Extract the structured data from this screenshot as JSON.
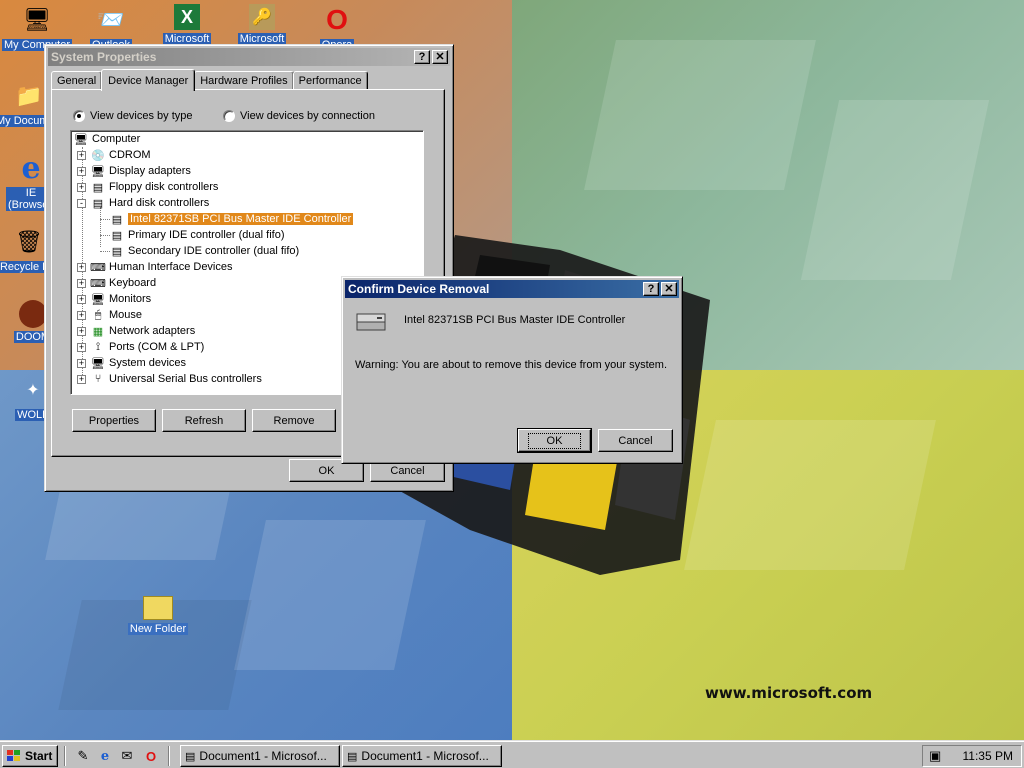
{
  "desktop": {
    "icons": [
      {
        "label": "My Computer",
        "icon": "computer-icon"
      },
      {
        "label": "Outlook",
        "icon": "outlook-icon"
      },
      {
        "label": "Microsoft",
        "icon": "excel-icon"
      },
      {
        "label": "Microsoft",
        "icon": "access-icon"
      },
      {
        "label": "Opera",
        "icon": "opera-icon"
      },
      {
        "label": "My Documents",
        "icon": "folder-icon"
      },
      {
        "label": "IE (Browser)",
        "icon": "internet-explorer-icon"
      },
      {
        "label": "Recycle Bin",
        "icon": "recycle-bin-icon"
      },
      {
        "label": "DOOM",
        "icon": "doom-icon"
      },
      {
        "label": "WOLF",
        "icon": "wolf-icon"
      },
      {
        "label": "New Folder",
        "icon": "folder-icon"
      }
    ],
    "wallpaper_text": "www.microsoft.com"
  },
  "system_properties": {
    "title": "System Properties",
    "tabs": [
      "General",
      "Device Manager",
      "Hardware Profiles",
      "Performance"
    ],
    "active_tab": "Device Manager",
    "radio_by_type": "View devices by type",
    "radio_by_connection": "View devices by connection",
    "selected_view": "View devices by type",
    "tree": [
      {
        "label": "Computer",
        "level": 0,
        "icon": "computer-icon"
      },
      {
        "label": "CDROM",
        "level": 1,
        "expander": "+",
        "icon": "cdrom-icon"
      },
      {
        "label": "Display adapters",
        "level": 1,
        "expander": "+",
        "icon": "monitor-icon"
      },
      {
        "label": "Floppy disk controllers",
        "level": 1,
        "expander": "+",
        "icon": "floppy-controller-icon"
      },
      {
        "label": "Hard disk controllers",
        "level": 1,
        "expander": "-",
        "icon": "disk-controller-icon"
      },
      {
        "label": "Intel 82371SB PCI Bus Master IDE Controller",
        "level": 2,
        "icon": "disk-controller-icon",
        "selected": true
      },
      {
        "label": "Primary IDE controller (dual fifo)",
        "level": 2,
        "icon": "disk-controller-icon"
      },
      {
        "label": "Secondary IDE controller (dual fifo)",
        "level": 2,
        "icon": "disk-controller-icon"
      },
      {
        "label": "Human Interface Devices",
        "level": 1,
        "expander": "+",
        "icon": "hid-icon"
      },
      {
        "label": "Keyboard",
        "level": 1,
        "expander": "+",
        "icon": "keyboard-icon"
      },
      {
        "label": "Monitors",
        "level": 1,
        "expander": "+",
        "icon": "monitor-icon"
      },
      {
        "label": "Mouse",
        "level": 1,
        "expander": "+",
        "icon": "mouse-icon"
      },
      {
        "label": "Network adapters",
        "level": 1,
        "expander": "+",
        "icon": "network-icon"
      },
      {
        "label": "Ports (COM & LPT)",
        "level": 1,
        "expander": "+",
        "icon": "port-icon"
      },
      {
        "label": "System devices",
        "level": 1,
        "expander": "+",
        "icon": "system-device-icon"
      },
      {
        "label": "Universal Serial Bus controllers",
        "level": 1,
        "expander": "+",
        "icon": "usb-icon"
      }
    ],
    "buttons": {
      "properties": "Properties",
      "refresh": "Refresh",
      "remove": "Remove",
      "ok": "OK",
      "cancel": "Cancel"
    }
  },
  "confirm_dialog": {
    "title": "Confirm Device Removal",
    "device": "Intel 82371SB PCI Bus Master IDE Controller",
    "warning": "Warning: You are about to remove this device from your system.",
    "ok": "OK",
    "cancel": "Cancel"
  },
  "taskbar": {
    "start": "Start",
    "quick_launch": [
      "desktop-icon",
      "internet-explorer-icon",
      "outlook-express-icon",
      "opera-icon"
    ],
    "tasks": [
      "Document1 - Microsof...",
      "Document1 - Microsof..."
    ],
    "clock": "11:35 PM"
  },
  "colors": {
    "selection": "#e1881a",
    "titlebar_active": "#0a246a",
    "face": "#c0c0c0"
  }
}
